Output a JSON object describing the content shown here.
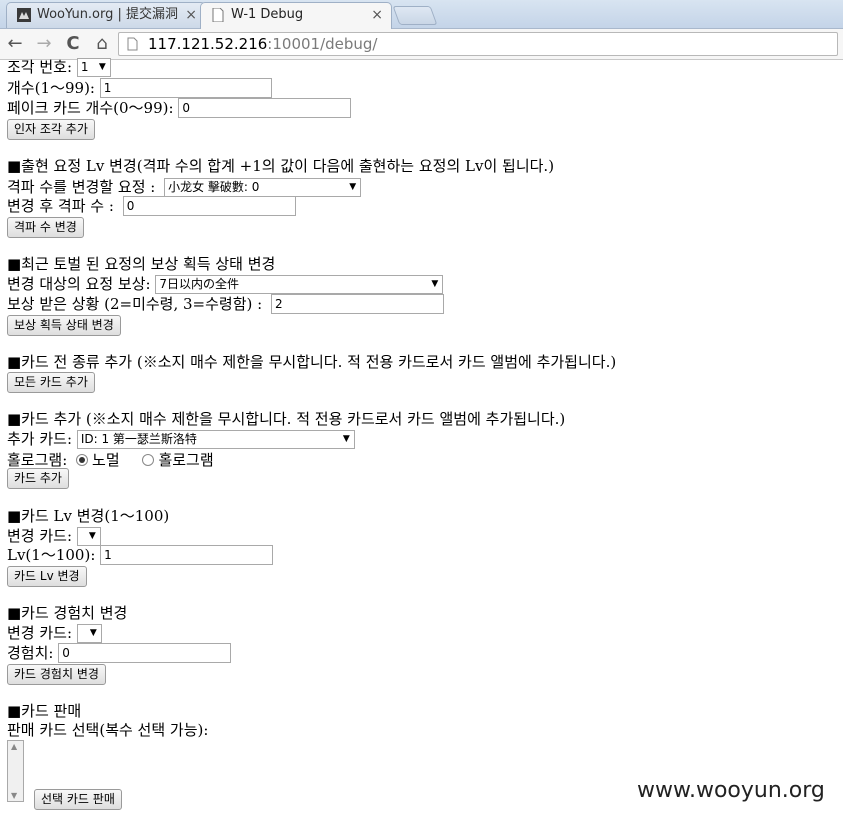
{
  "browser": {
    "tabs": [
      {
        "title": "WooYun.org | 提交漏洞",
        "icon": "wooyun-favicon",
        "close": "×"
      },
      {
        "title": "W-1 Debug",
        "icon": "page-favicon",
        "close": "×"
      }
    ],
    "nav": {
      "back": "←",
      "forward": "→",
      "reload": "C",
      "home": "⌂"
    },
    "url_host": "117.121.52.216",
    "url_rest": ":10001/debug/"
  },
  "sec_fragment": {
    "piece_no_label": "조각 번호:",
    "piece_no_value": "1",
    "count_label": "개수(1～99):",
    "count_value": "1",
    "fake_count_label": "페이크 카드 개수(0～99):",
    "fake_count_value": "0",
    "button": "인자 조각 추가"
  },
  "sec_appear": {
    "heading": "■출현 요정 Lv 변경(격파 수의 합계 +1의 값이 다음에 출현하는 요정의 Lv이 됩니다.)",
    "fairy_label": "격파 수를 변경할 요정 :",
    "fairy_value": "小龙女 擊破數: 0",
    "after_label": "변경 후 격파 수 :",
    "after_value": "0",
    "button": "격파 수 변경"
  },
  "sec_reward": {
    "heading": "■최근 토벌 된 요정의 보상 획득 상태 변경",
    "target_label": "변경 대상의 요정 보상:",
    "target_value": "7日以内の全件",
    "status_label": "보상 받은 상황 (2=미수령, 3=수령함) :",
    "status_value": "2",
    "button": "보상 획득 상태 변경"
  },
  "sec_allcards": {
    "heading": "■카드 전 종류 추가 (※소지 매수 제한을 무시합니다. 적 전용 카드로서 카드 앨범에 추가됩니다.)",
    "button": "모든 카드 추가"
  },
  "sec_addcard": {
    "heading": "■카드 추가 (※소지 매수 제한을 무시합니다. 적 전용 카드로서 카드 앨범에 추가됩니다.)",
    "card_label": "추가 카드:",
    "card_value": "ID: 1 第一瑟兰斯洛特",
    "holo_label": "홀로그램:",
    "radio_normal": "노멀",
    "radio_holo": "홀로그램",
    "button": "카드 추가"
  },
  "sec_cardlv": {
    "heading": "■카드 Lv 변경(1～100)",
    "card_label": "변경 카드:",
    "lv_label": "Lv(1～100):",
    "lv_value": "1",
    "button": "카드 Lv 변경"
  },
  "sec_exp": {
    "heading": "■카드 경험치 변경",
    "card_label": "변경 카드:",
    "exp_label": "경험치:",
    "exp_value": "0",
    "button": "카드 경험치 변경"
  },
  "sec_sell": {
    "heading": "■카드 판매",
    "select_label": "판매 카드 선택(복수 선택 가능):",
    "button": "선택 카드 판매"
  },
  "watermark": "www.wooyun.org"
}
